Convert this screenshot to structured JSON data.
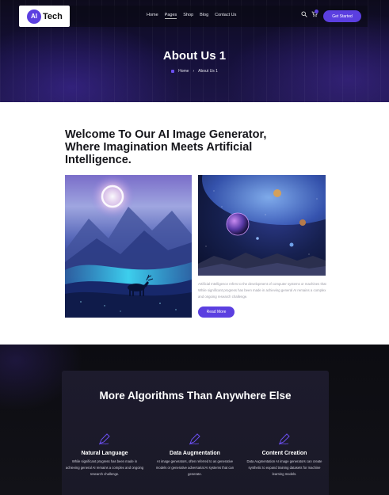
{
  "header": {
    "logo_mark": "AI",
    "logo_text": "Tech",
    "nav": [
      "Home",
      "Pages",
      "Shop",
      "Blog",
      "Contact Us"
    ],
    "cta": "Get Started"
  },
  "hero": {
    "title": "About Us 1",
    "breadcrumb": [
      "Home",
      "About Us 1"
    ]
  },
  "welcome": {
    "title": "Welcome To Our AI Image Generator, Where Imagination Meets Artificial Intelligence.",
    "description": "Artificial Intelligence refers to the development of computer systems or machines that While significant progress has been made in achieving general AI remains a complex and ongoing research challenge.",
    "button": "Read More"
  },
  "features": {
    "title": "More Algorithms Than Anywhere Else",
    "items": [
      {
        "name": "Natural Language",
        "desc": "While significant progress has been made in achieving general AI remains a complex and ongoing research challenge.",
        "icon": "pen-icon"
      },
      {
        "name": "Data Augmentation",
        "desc": "AI image generators, often referred to as generative models or generative adversarial AI systems that can generate.",
        "icon": "pen-icon"
      },
      {
        "name": "Content Creation",
        "desc": "Data Augmentation AI image generators can create synthetic to expand training datasets for machine learning models.",
        "icon": "pen-icon"
      }
    ]
  },
  "colors": {
    "accent": "#5b3fe0",
    "dark_bg": "#0f0f14",
    "panel_bg": "#1d1b2d"
  }
}
